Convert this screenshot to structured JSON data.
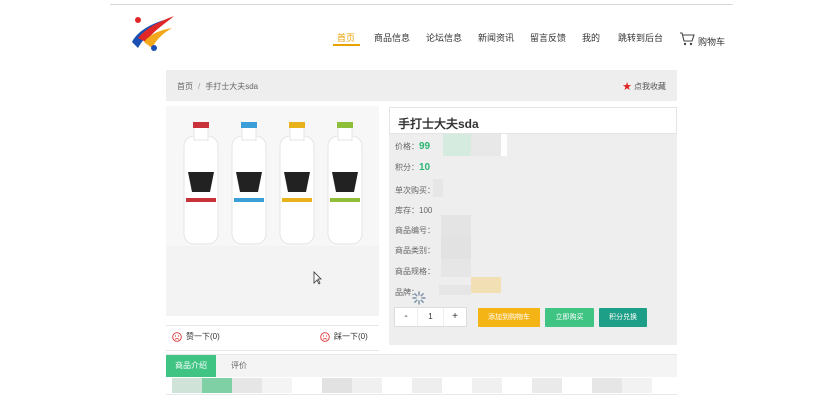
{
  "nav": {
    "items": [
      {
        "label": "首页",
        "active": true
      },
      {
        "label": "商品信息"
      },
      {
        "label": "论坛信息"
      },
      {
        "label": "新闻资讯"
      },
      {
        "label": "留言反馈"
      },
      {
        "label": "我的"
      },
      {
        "label": "跳转到后台"
      }
    ],
    "cart_label": "购物车"
  },
  "breadcrumb": {
    "home": "首页",
    "separator": "/",
    "current": "手打士大夫sda",
    "favorite_label": "点我收藏"
  },
  "product": {
    "title": "手打士大夫sda",
    "price_label": "价格：",
    "price_value": "99",
    "points_label": "积分：",
    "points_value": "10",
    "single_limit_label": "单次购买：",
    "stock_label": "库存：",
    "stock_value": "100",
    "code_label": "商品编号：",
    "category_label": "商品类别：",
    "spec_label": "商品规格：",
    "brand_label": "品牌："
  },
  "votes": {
    "like_label": "赞一下(0)",
    "dislike_label": "踩一下(0)"
  },
  "purchase": {
    "quantity": "1",
    "minus": "-",
    "plus": "+",
    "add_to_cart": "添加到购物车",
    "buy_now": "立即购买",
    "redeem_points": "积分兑换"
  },
  "tabs": {
    "intro": "商品介绍",
    "reviews": "评价"
  },
  "colors": {
    "accent_green": "#3fc484",
    "accent_orange": "#f5b416",
    "accent_teal": "#1d9e86",
    "nav_active": "#e8a200"
  }
}
